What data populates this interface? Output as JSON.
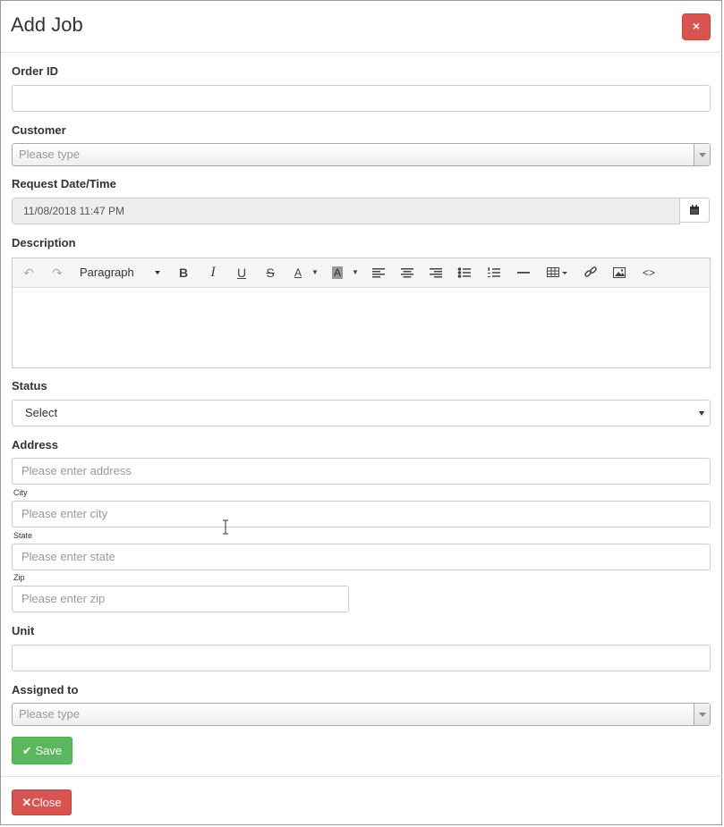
{
  "modal": {
    "title": "Add Job",
    "close_x": "×"
  },
  "fields": {
    "order_id": {
      "label": "Order ID",
      "value": ""
    },
    "customer": {
      "label": "Customer",
      "placeholder": "Please type"
    },
    "request_date": {
      "label": "Request Date/Time",
      "value": "11/08/2018 11:47 PM"
    },
    "description": {
      "label": "Description",
      "paragraph_label": "Paragraph"
    },
    "status": {
      "label": "Status",
      "selected": "Select"
    },
    "address": {
      "label": "Address",
      "placeholder": "Please enter address"
    },
    "city": {
      "label": "City",
      "placeholder": "Please enter city"
    },
    "state": {
      "label": "State",
      "placeholder": "Please enter state"
    },
    "zip": {
      "label": "Zip",
      "placeholder": "Please enter zip"
    },
    "unit": {
      "label": "Unit",
      "value": ""
    },
    "assigned_to": {
      "label": "Assigned to",
      "placeholder": "Please type"
    }
  },
  "toolbar_icons": [
    "undo-icon",
    "redo-icon",
    "bold-icon",
    "italic-icon",
    "underline-icon",
    "strikethrough-icon",
    "font-color-icon",
    "highlight-color-icon",
    "align-left-icon",
    "align-center-icon",
    "align-right-icon",
    "bullet-list-icon",
    "numbered-list-icon",
    "horizontal-rule-icon",
    "table-icon",
    "link-icon",
    "image-icon",
    "code-view-icon"
  ],
  "buttons": {
    "save": "Save",
    "close": "Close"
  },
  "colors": {
    "save": "#5cb85c",
    "danger": "#d9534f"
  }
}
